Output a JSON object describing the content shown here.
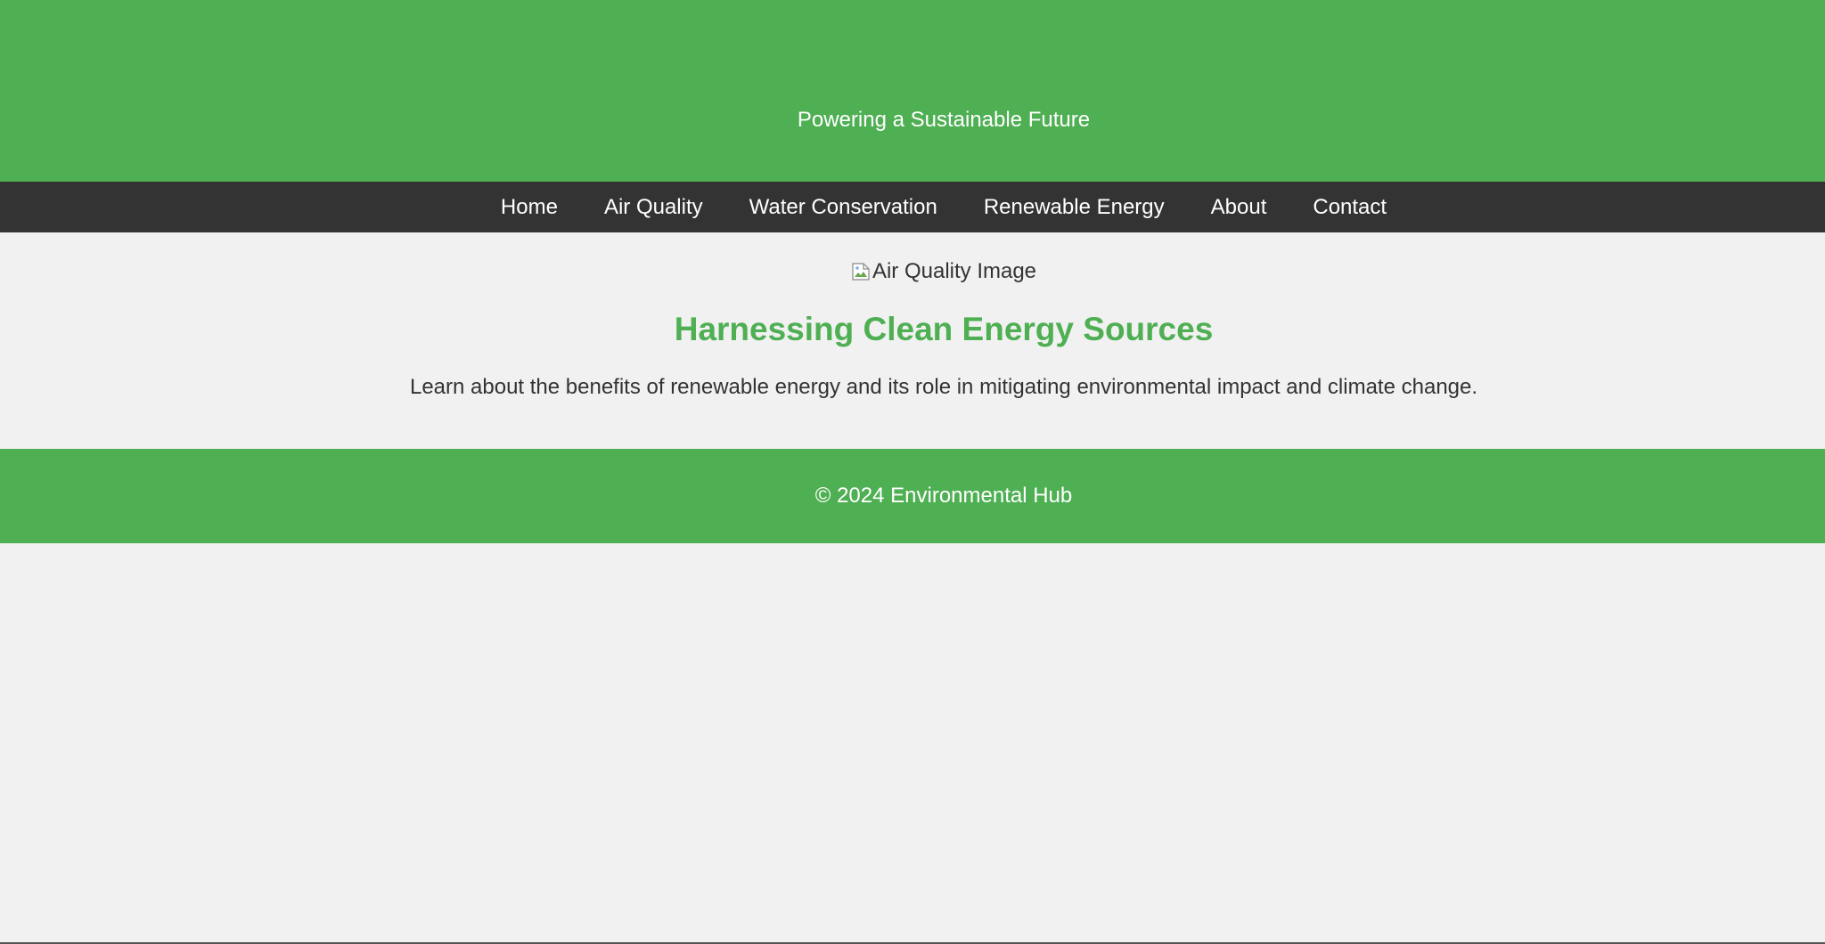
{
  "header": {
    "tagline": "Powering a Sustainable Future"
  },
  "nav": {
    "items": [
      {
        "label": "Home"
      },
      {
        "label": "Air Quality"
      },
      {
        "label": "Water Conservation"
      },
      {
        "label": "Renewable Energy"
      },
      {
        "label": "About"
      },
      {
        "label": "Contact"
      }
    ]
  },
  "main": {
    "image_alt": "Air Quality Image",
    "headline": "Harnessing Clean Energy Sources",
    "description": "Learn about the benefits of renewable energy and its role in mitigating environmental impact and climate change."
  },
  "footer": {
    "copyright": "© 2024 Environmental Hub"
  },
  "colors": {
    "brand_green": "#4faf53",
    "nav_dark": "#333333",
    "page_bg": "#f1f1f1",
    "text": "#333333"
  },
  "icons": {
    "broken_image": "broken-image-icon"
  }
}
